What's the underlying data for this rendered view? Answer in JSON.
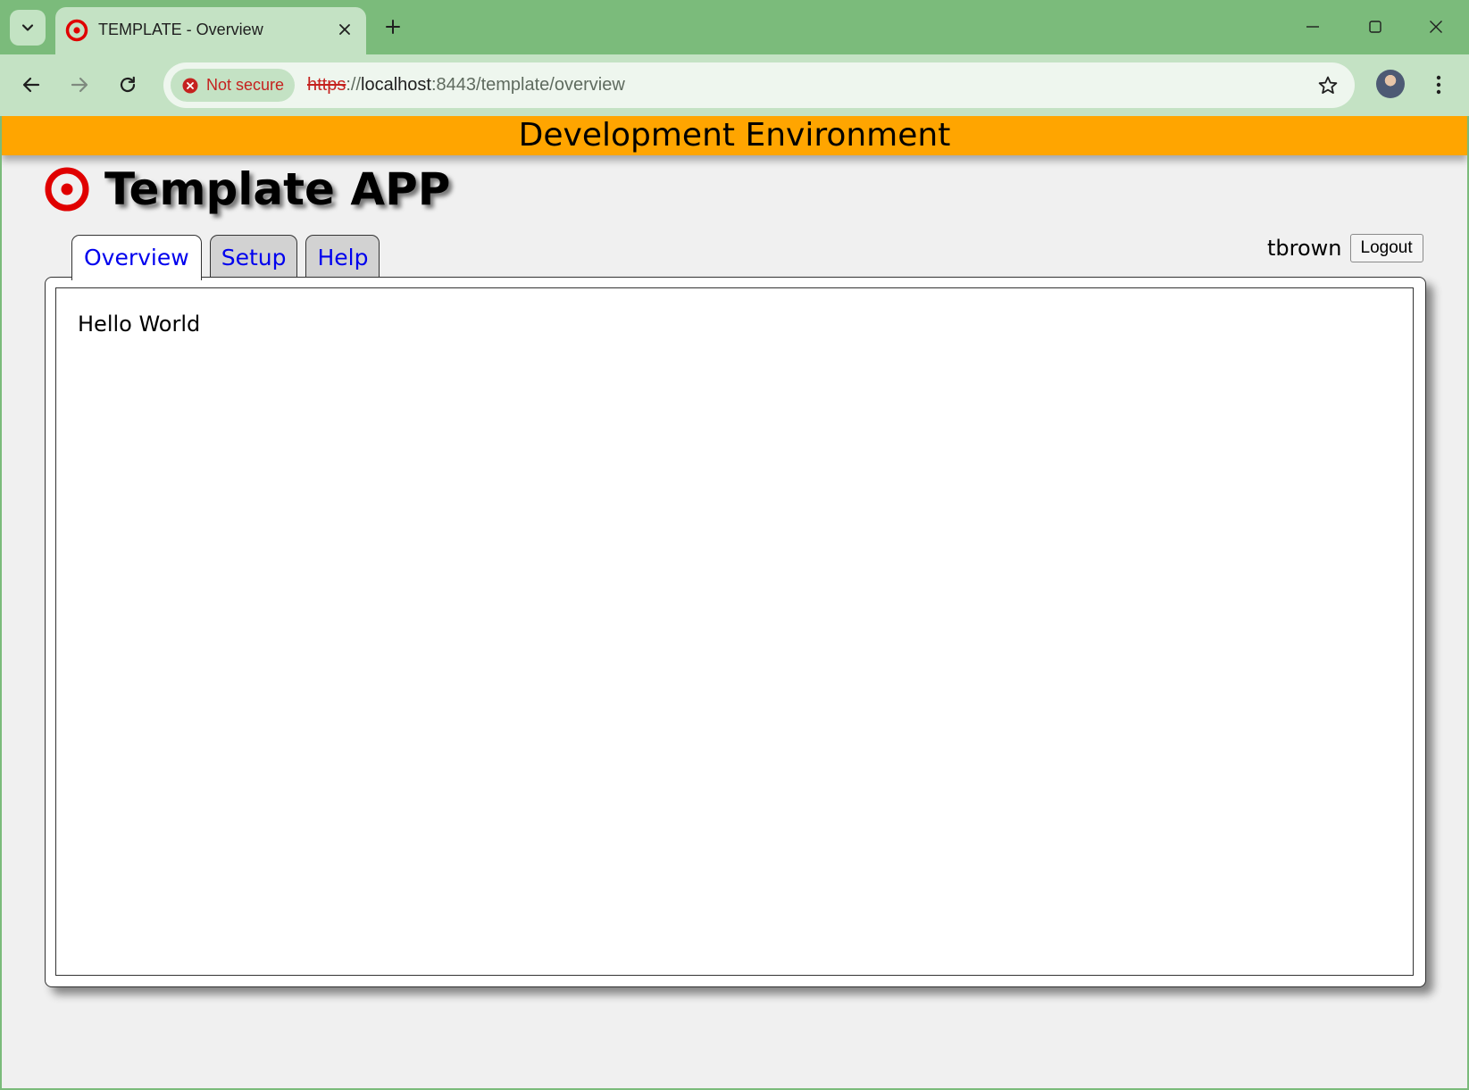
{
  "browser": {
    "tab_title": "TEMPLATE - Overview",
    "security_label": "Not secure",
    "url_scheme": "https",
    "url_separator": "://",
    "url_host": "localhost",
    "url_rest": ":8443/template/overview",
    "colors": {
      "frame": "#7bbb7b",
      "toolbar": "#c4e2c4",
      "warning": "#c5221f"
    }
  },
  "page": {
    "environment_banner": "Development Environment",
    "app_title": "Template APP",
    "tabs": [
      {
        "label": "Overview",
        "active": true
      },
      {
        "label": "Setup",
        "active": false
      },
      {
        "label": "Help",
        "active": false
      }
    ],
    "username": "tbrown",
    "logout_label": "Logout",
    "content": "Hello World",
    "colors": {
      "banner": "#ffa500",
      "tab_link": "#0000ee",
      "logo": "#e00000"
    }
  },
  "icons": {
    "tab_search": "chevron-down-icon",
    "favicon": "target-icon",
    "tab_close": "close-icon",
    "new_tab": "plus-icon",
    "back": "arrow-left-icon",
    "forward": "arrow-right-icon",
    "reload": "reload-icon",
    "security": "error-circle-icon",
    "bookmark": "star-icon",
    "menu": "kebab-menu-icon"
  }
}
